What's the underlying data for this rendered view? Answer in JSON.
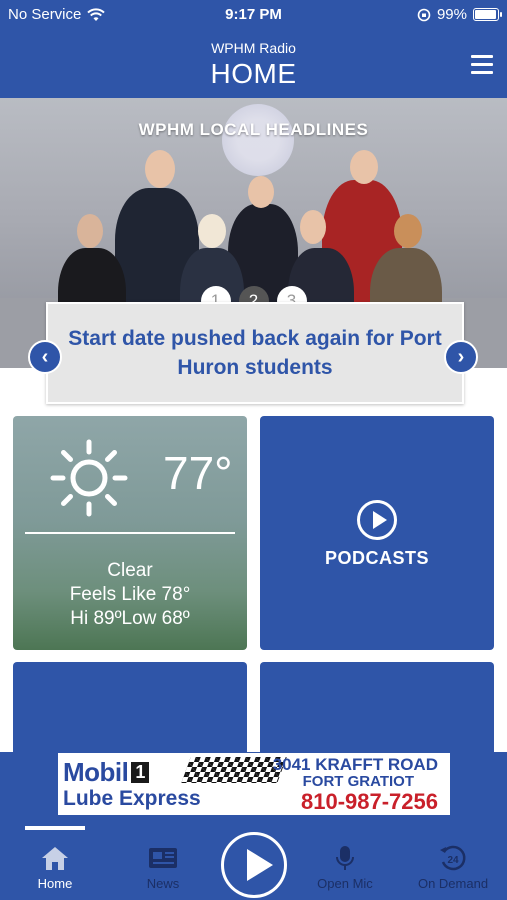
{
  "status_bar": {
    "carrier": "No Service",
    "time": "9:17 PM",
    "battery": "99%",
    "battery_level": 0.99
  },
  "header": {
    "subtitle": "WPHM Radio",
    "title": "HOME",
    "menu_icon": "hamburger-menu-icon"
  },
  "hero": {
    "heading": "WPHM LOCAL HEADLINES",
    "pages": [
      "1",
      "2",
      "3"
    ],
    "active_page": 2,
    "headline": "Start date pushed back again for Port Huron students",
    "prev_icon": "chevron-left-icon",
    "next_icon": "chevron-right-icon"
  },
  "weather": {
    "icon": "sun-icon",
    "temperature": "77°",
    "condition": "Clear",
    "feels_like": "Feels Like 78°",
    "hi_low": "Hi 89ºLow 68º"
  },
  "podcasts": {
    "label": "PODCASTS",
    "icon": "play-circle-icon"
  },
  "ad": {
    "brand": "Mobil",
    "brand_number": "1",
    "line2": "Lube Express",
    "address": "3041 KRAFFT ROAD",
    "city": "FORT GRATIOT",
    "phone": "810-987-7256"
  },
  "tabs": [
    {
      "label": "Home",
      "icon": "home-icon"
    },
    {
      "label": "News",
      "icon": "newspaper-icon"
    },
    {
      "label": "Open Mic",
      "icon": "microphone-icon"
    },
    {
      "label": "On Demand",
      "icon": "history-24-icon"
    }
  ],
  "colors": {
    "brand_blue": "#2f55a8",
    "tab_inactive": "#1b2f66",
    "ad_red": "#c9202a"
  }
}
